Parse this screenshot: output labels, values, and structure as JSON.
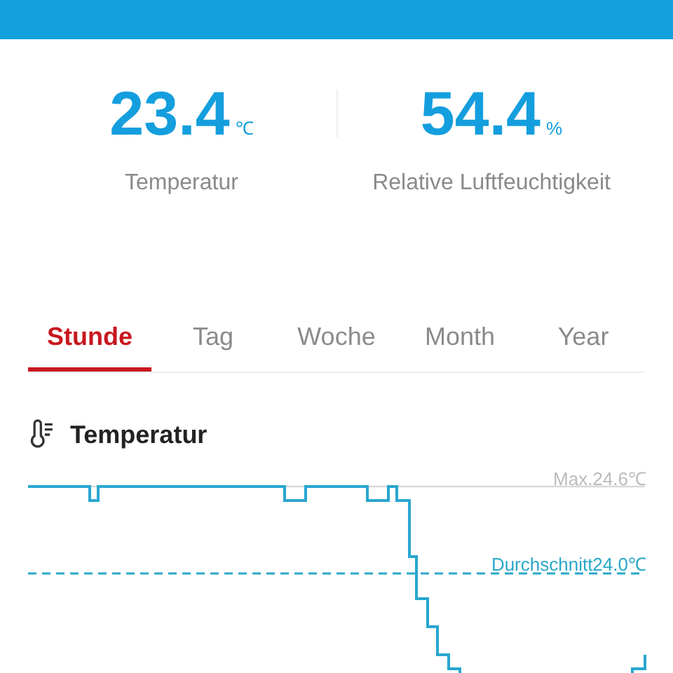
{
  "readings": [
    {
      "value": "23.4",
      "unit": "℃",
      "label": "Temperatur"
    },
    {
      "value": "54.4",
      "unit": "%",
      "label": "Relative Luftfeuchtigkeit"
    }
  ],
  "tabs": [
    {
      "label": "Stunde",
      "selected": true
    },
    {
      "label": "Tag",
      "selected": false
    },
    {
      "label": "Woche",
      "selected": false
    },
    {
      "label": "Month",
      "selected": false
    },
    {
      "label": "Year",
      "selected": false
    }
  ],
  "chart": {
    "title": "Temperatur",
    "max_label": "Max.24.6℃",
    "average_label": "Durchschnitt24.0℃"
  }
}
